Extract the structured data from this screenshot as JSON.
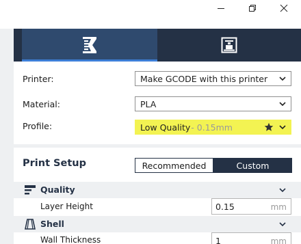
{
  "window": {
    "minimize_icon": "minimize-icon",
    "restore_icon": "restore-icon",
    "close_icon": "close-icon"
  },
  "mode_tabs": [
    {
      "name": "prepare",
      "icon": "slice-icon",
      "active": true
    },
    {
      "name": "monitor",
      "icon": "monitor-printer-icon",
      "active": false
    }
  ],
  "printer_settings": {
    "printer": {
      "label": "Printer:",
      "value": "Make GCODE with this printer"
    },
    "material": {
      "label": "Material:",
      "value": "PLA"
    },
    "profile": {
      "label": "Profile:",
      "value": "Low Quality",
      "suffix": " - 0.15mm",
      "highlight_color": "#f3f352"
    }
  },
  "print_setup": {
    "title": "Print Setup",
    "modes": {
      "recommended": "Recommended",
      "custom": "Custom"
    },
    "selected_mode": "Custom"
  },
  "categories": {
    "quality": {
      "label": "Quality",
      "icon": "quality-layers-icon",
      "settings": [
        {
          "label": "Layer Height",
          "value": "0.15",
          "unit": "mm"
        }
      ]
    },
    "shell": {
      "label": "Shell",
      "icon": "shell-icon",
      "settings": [
        {
          "label": "Wall Thickness",
          "value": "1",
          "unit": "mm"
        }
      ]
    }
  },
  "colors": {
    "accent_dark": "#243145",
    "tab_active": "#2f4a6e",
    "highlight_yellow": "#f3f352"
  }
}
